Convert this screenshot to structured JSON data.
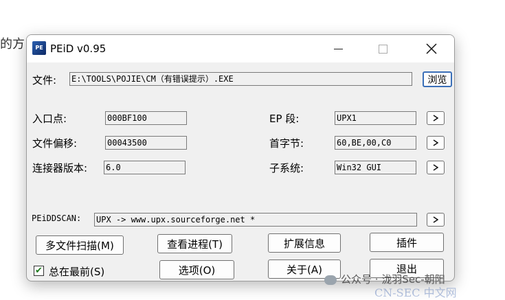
{
  "background": {
    "partial_text": "的方"
  },
  "window": {
    "title": "PEiD v0.95",
    "icon": "peid-app-icon"
  },
  "file_row": {
    "label": "文件:",
    "path": "E:\\TOOLS\\POJIE\\CM（有错误提示）.EXE",
    "browse_label": "浏览"
  },
  "fields": {
    "entry_point": {
      "label": "入口点:",
      "value": "000BF100"
    },
    "file_offset": {
      "label": "文件偏移:",
      "value": "00043500"
    },
    "linker_version": {
      "label": "连接器版本:",
      "value": "6.0"
    },
    "ep_section": {
      "label": "EP 段:",
      "value": "UPX1"
    },
    "first_bytes": {
      "label": "首字节:",
      "value": "60,BE,00,C0"
    },
    "subsystem": {
      "label": "子系统:",
      "value": "Win32 GUI"
    }
  },
  "scan": {
    "label": "PEiDDSCAN:",
    "value": "UPX -> www.upx.sourceforge.net *"
  },
  "buttons": {
    "multi_scan": "多文件扫描(M)",
    "view_process": "查看进程(T)",
    "extensions": "扩展信息",
    "plugins": "插件",
    "options": "选项(O)",
    "about": "关于(A)",
    "exit": "退出"
  },
  "always_on_top": {
    "label": "总在最前(S)",
    "checked": true
  },
  "watermark": {
    "text": "公众号 · 泷羽Sec-朝阳",
    "site": "CN-SEC 中文网"
  }
}
